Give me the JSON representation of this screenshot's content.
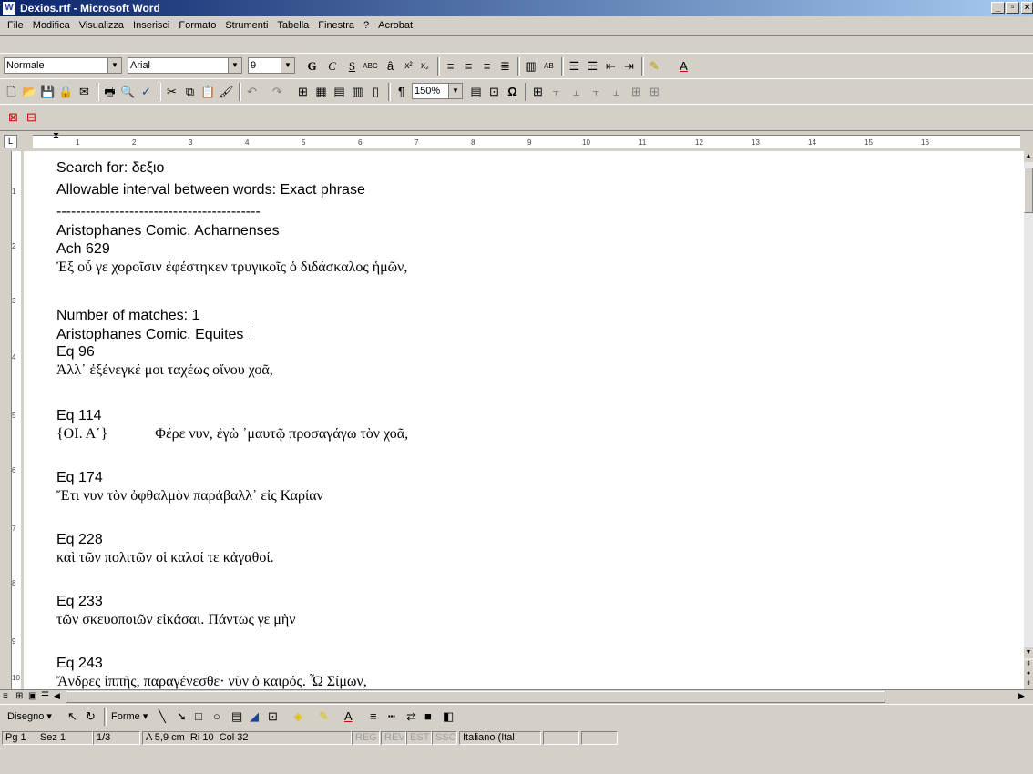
{
  "window": {
    "title": "Dexios.rtf - Microsoft Word",
    "app_icon": "W"
  },
  "menu": [
    "File",
    "Modifica",
    "Visualizza",
    "Inserisci",
    "Formato",
    "Strumenti",
    "Tabella",
    "Finestra",
    "?",
    "Acrobat"
  ],
  "format_toolbar": {
    "style": "Normale",
    "font": "Arial",
    "size": "9",
    "bold": "G",
    "italic": "C",
    "underline": "S",
    "zoom": "150%"
  },
  "document": {
    "lines": [
      {
        "text": "Search for:  δεξιο",
        "font": "sans"
      },
      {
        "text": "Allowable interval between words: Exact phrase",
        "font": "sans"
      },
      {
        "text": "------------------------------------------",
        "font": "sans"
      },
      {
        "text": " Aristophanes Comic.  Acharnenses",
        "font": "sans"
      },
      {
        "text": "Ach 629",
        "font": "sans"
      },
      {
        "text": "Ἐξ οὗ γε χοροῖσιν ἐφέστηκεν τρυγικοῖς ὁ διδάσκαλος ἡμῶν,",
        "font": "serif"
      },
      {
        "text": "Number of matches:  1",
        "font": "sans"
      },
      {
        "text": " Aristophanes Comic.  Equites",
        "font": "sans"
      },
      {
        "text": "Eq 96",
        "font": "sans"
      },
      {
        "text": "Ἀλλ᾽ ἐξένεγκέ μοι ταχέως οἴνου χοᾶ,",
        "font": "serif"
      },
      {
        "text": "Eq 114",
        "font": "sans"
      },
      {
        "text": "{ΟΙ. Α΄}             Φέρε νυν, ἐγὼ ᾽μαυτῷ προσαγάγω τὸν χοᾶ,",
        "font": "serif"
      },
      {
        "text": "Eq 174",
        "font": "sans"
      },
      {
        "text": "Ἔτι νυν τὸν ὀφθαλμὸν παράβαλλ᾽ εἰς Καρίαν",
        "font": "serif"
      },
      {
        "text": "Eq 228",
        "font": "sans"
      },
      {
        "text": "καὶ τῶν πολιτῶν οἱ καλοί τε κἀγαθοί.",
        "font": "serif"
      },
      {
        "text": "Eq 233",
        "font": "sans"
      },
      {
        "text": "τῶν σκευοποιῶν εἰκάσαι. Πάντως γε μὴν",
        "font": "serif"
      },
      {
        "text": "Eq 243",
        "font": "sans"
      },
      {
        "text": "Ἄνδρες ἱππῆς, παραγένεσθε· νῦν ὁ καιρός. Ὦ Σίμων,",
        "font": "serif"
      }
    ]
  },
  "ruler_numbers": [
    "1",
    "2",
    "3",
    "4",
    "5",
    "6",
    "7",
    "8",
    "9",
    "10",
    "11",
    "12",
    "13",
    "14",
    "15",
    "16"
  ],
  "vruler_numbers": [
    "1",
    "2",
    "3",
    "4",
    "5",
    "6",
    "7",
    "8",
    "9",
    "10"
  ],
  "drawing_toolbar": {
    "draw": "Disegno",
    "shapes": "Forme"
  },
  "status": {
    "page": "Pg 1",
    "section": "Sez 1",
    "pages": "1/3",
    "at": "A 5,9 cm",
    "line": "Ri 10",
    "col": "Col 32",
    "rec": "REG",
    "rev": "REV",
    "ext": "EST",
    "ovr": "SSC",
    "language": "Italiano (Ital"
  }
}
